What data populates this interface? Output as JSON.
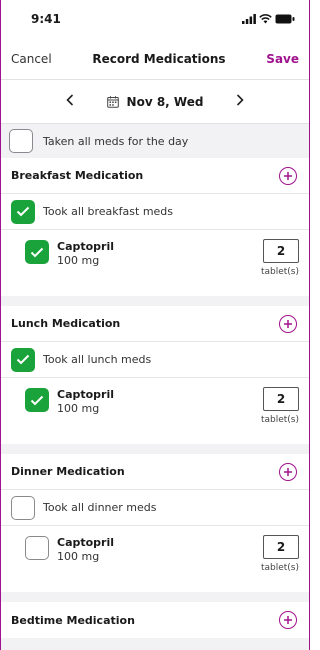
{
  "status": {
    "time": "9:41"
  },
  "nav": {
    "cancel": "Cancel",
    "title": "Record Medications",
    "save": "Save"
  },
  "date": {
    "label": "Nov 8, Wed",
    "prev": "‹",
    "next": "›"
  },
  "all_day": {
    "label": "Taken all meds for the day",
    "checked": false
  },
  "sections": {
    "breakfast": {
      "title": "Breakfast Medication",
      "took_label": "Took all breakfast meds",
      "med": {
        "name": "Captopril",
        "dose": "100 mg",
        "qty": "2",
        "unit": "tablet(s)"
      }
    },
    "lunch": {
      "title": "Lunch Medication",
      "took_label": "Took all lunch meds",
      "med": {
        "name": "Captopril",
        "dose": "100 mg",
        "qty": "2",
        "unit": "tablet(s)"
      }
    },
    "dinner": {
      "title": "Dinner Medication",
      "took_label": "Took all dinner meds",
      "med": {
        "name": "Captopril",
        "dose": "100 mg",
        "qty": "2",
        "unit": "tablet(s)"
      }
    },
    "bedtime": {
      "title": "Bedtime Medication"
    }
  },
  "colors": {
    "accent": "#a0138e",
    "checked": "#1aa33a"
  },
  "icons": [
    "signal-icon",
    "wifi-icon",
    "battery-icon",
    "calendar-icon",
    "plus-circle-icon",
    "check-icon"
  ]
}
